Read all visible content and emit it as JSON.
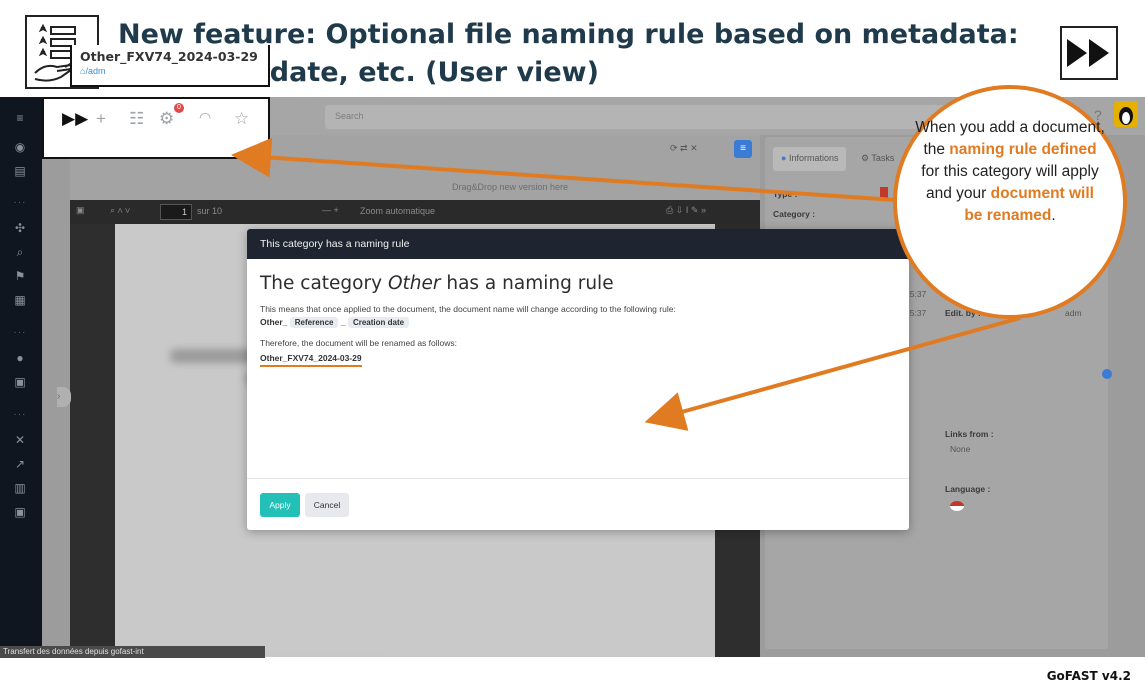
{
  "slide": {
    "title": "New feature: Optional file naming rule based on metadata: category, date, etc. (User view)",
    "version": "GoFAST v4.2"
  },
  "topbar": {
    "search_placeholder": "Search",
    "notification_count": "0"
  },
  "document": {
    "name": "Other_FXV74_2024-03-29",
    "path": "/adm",
    "dragdrop": "Drag&Drop new version here"
  },
  "pdf_toolbar": {
    "page": "1",
    "page_of": "sur 10",
    "zoom": "Zoom automatique"
  },
  "right_panel": {
    "tab_info": "Informations",
    "tab_tasks": "Tasks",
    "type_label": "Type :",
    "category_label": "Category :",
    "time1": "15:37",
    "time2": "15:37",
    "edit_by_label": "Edit. by :",
    "edit_by_value": "adm",
    "links_from_label": "Links from :",
    "links_from_value": "None",
    "language_label": "Language :"
  },
  "modal": {
    "header": "This category has a naming rule",
    "title_pre": "The category ",
    "title_cat": "Other",
    "title_post": " has a naming rule",
    "text1": "This means that once applied to the document, the document name will change according to the following rule:",
    "rule_prefix": "Other_",
    "rule_tag1": "Reference",
    "rule_sep": "_",
    "rule_tag2": "Creation date",
    "text2": "Therefore, the document will be renamed as follows:",
    "renamed": "Other_FXV74_2024-03-29",
    "apply": "Apply",
    "cancel": "Cancel"
  },
  "callout": {
    "part1": "When you add a document, the ",
    "hl1": "naming rule defined",
    "part2": " for this category will apply and your ",
    "hl2": "document will be renamed",
    "part3": "."
  },
  "status_bar": "Transfert des données depuis gofast-int"
}
